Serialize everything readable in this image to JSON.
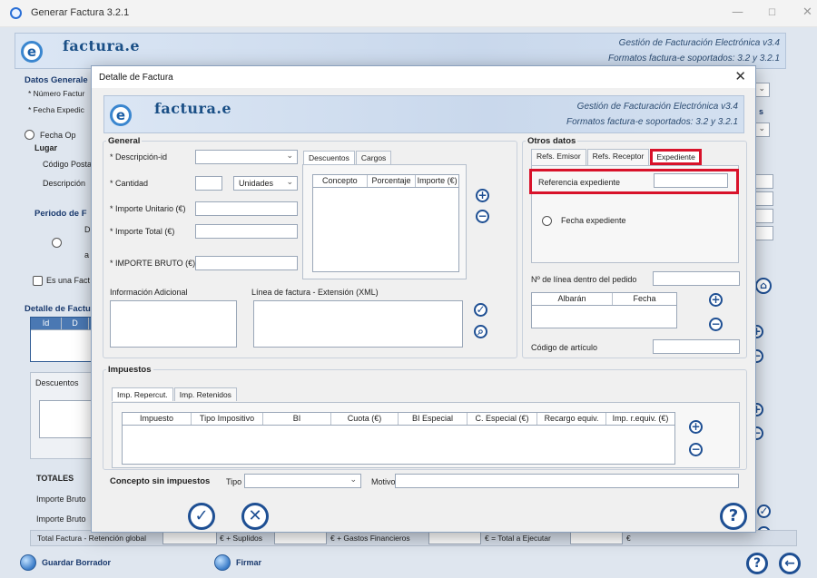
{
  "window": {
    "title": "Generar Factura 3.2.1",
    "min": "—",
    "max": "☐",
    "close": "✕"
  },
  "banner": {
    "logo": "factura.e",
    "line1": "Gestión de Facturación Electrónica v3.4",
    "line2": "Formatos factura-e soportados: 3.2 y 3.2.1"
  },
  "background": {
    "datos_generales": "Datos Generale",
    "numero_factura": "* Número Factur",
    "fecha_expedicion": "* Fecha Expedic",
    "fecha_op": "Fecha Op",
    "lugar": "Lugar",
    "codigo_postal": "Código Posta",
    "descripcion": "Descripción",
    "periodo": "Periodo de F",
    "periodo_d": "D",
    "periodo_a": "a",
    "es_una": "Es una Fact",
    "detalle": "Detalle de Factu",
    "detalle_id": "Id",
    "detalle_d": "D",
    "descuentos": "Descuentos",
    "totales": "TOTALES",
    "importe_bruto_1": "Importe Bruto",
    "importe_bruto_2": "Importe Bruto",
    "total_factura": "Total Factura  -  Retención global",
    "suplidos": "€  +  Suplidos",
    "gastos": "€  +  Gastos Financieros",
    "total_ejecutar": "€  =  Total a Ejecutar",
    "euro": "€",
    "guardar": "Guardar Borrador",
    "firmar": "Firmar",
    "side_s": "s"
  },
  "dialog": {
    "title": "Detalle de Factura",
    "general": {
      "heading": "General",
      "descripcion_id": "* Descripción-id",
      "cantidad": "* Cantidad",
      "unidades": "Unidades",
      "importe_unitario": "* Importe Unitario (€)",
      "importe_total": "* Importe Total (€)",
      "importe_bruto": "* IMPORTE BRUTO (€)"
    },
    "descuentos_tabs": [
      "Descuentos",
      "Cargos"
    ],
    "descuentos_cols": [
      "Concepto",
      "Porcentaje",
      "Importe (€)"
    ],
    "info_adicional": "Información Adicional",
    "linea_factura": "Línea de factura - Extensión (XML)",
    "otros_datos": {
      "heading": "Otros datos",
      "tabs": [
        "Refs. Emisor",
        "Refs. Receptor",
        "Expediente"
      ],
      "referencia_expediente": "Referencia expediente",
      "fecha_expediente": "Fecha expediente",
      "num_linea_pedido": "Nº de línea dentro del pedido",
      "albaran_cols": [
        "Albarán",
        "Fecha"
      ],
      "codigo_articulo": "Código de artículo"
    },
    "impuestos": {
      "heading": "Impuestos",
      "tabs": [
        "Imp. Repercut.",
        "Imp. Retenidos"
      ],
      "cols": [
        "Impuesto",
        "Tipo Impositivo",
        "BI",
        "Cuota (€)",
        "BI Especial",
        "C. Especial (€)",
        "Recargo equiv.",
        "Imp. r.equiv. (€)"
      ]
    },
    "concepto_sin_impuestos": "Concepto sin impuestos",
    "tipo": "Tipo",
    "motivo": "Motivo"
  }
}
